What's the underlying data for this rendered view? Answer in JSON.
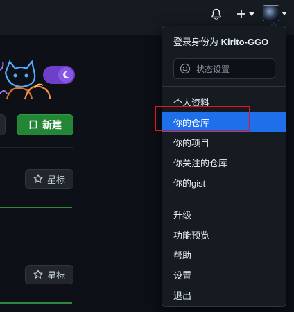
{
  "header": {
    "bell_icon": "bell-icon",
    "plus_icon": "plus-icon",
    "avatar_icon": "avatar-icon"
  },
  "toolbar": {
    "new_label": "新建",
    "new_icon": "repo-icon"
  },
  "repos": [
    {
      "star_label": "星标"
    },
    {
      "star_label": "星标"
    }
  ],
  "menu": {
    "signed_in_prefix": "登录身份为",
    "username": "Kirito-GGO",
    "status_placeholder": "状态设置",
    "group1": [
      "个人资料",
      "你的仓库",
      "你的项目",
      "你关注的仓库",
      "你的gist"
    ],
    "group2": [
      "升级",
      "功能预览",
      "帮助",
      "设置",
      "退出"
    ],
    "active_item": "你的仓库"
  },
  "colors": {
    "accent": "#1f6feb",
    "primary_button": "#238636",
    "highlight_border": "#e5141d",
    "toggle": "#6e40c9"
  }
}
